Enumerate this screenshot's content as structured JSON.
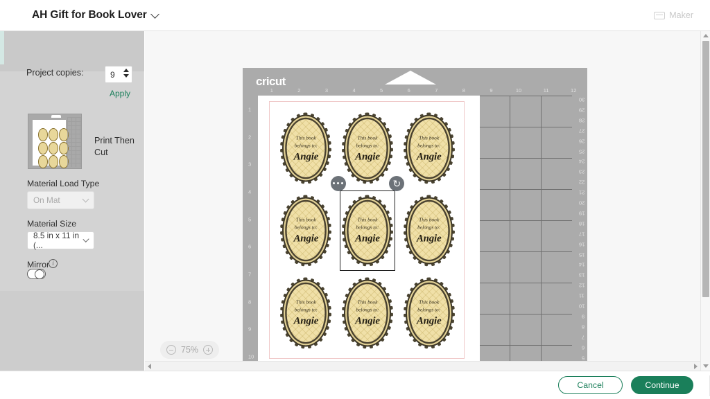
{
  "topbar": {
    "project_title": "AH Gift for Book Lover",
    "dropdown_icon": "chevron-down-icon",
    "machine_label": "Maker",
    "machine_icon": "cutting-machine-icon"
  },
  "sidebar": {
    "copies_label": "Project copies:",
    "copies_value": "9",
    "apply_label": "Apply",
    "operation_label": "Print Then Cut",
    "material_load_type_label": "Material Load Type",
    "material_load_type_value": "On Mat",
    "material_size_label": "Material Size",
    "material_size_value": "8.5 in x 11 in (...",
    "mirror_label": "Mirror",
    "mirror_info_icon": "info-icon",
    "mirror_state": "off"
  },
  "canvas": {
    "mat_brand": "cricut",
    "ruler_top": [
      "1",
      "2",
      "3",
      "4",
      "5",
      "6",
      "7",
      "8",
      "9",
      "10",
      "11",
      "12"
    ],
    "ruler_left": [
      "1",
      "2",
      "3",
      "4",
      "5",
      "6",
      "7",
      "8",
      "9",
      "10"
    ],
    "ruler_right": [
      "30",
      "29",
      "28",
      "27",
      "26",
      "25",
      "24",
      "23",
      "22",
      "21",
      "20",
      "19",
      "18",
      "17",
      "16",
      "15",
      "14",
      "13",
      "12",
      "11",
      "10",
      "9",
      "8",
      "7",
      "6",
      "5"
    ],
    "zoom_level": "75%",
    "zoom_out_icon": "minus-circle-icon",
    "zoom_in_icon": "plus-circle-icon",
    "selection": {
      "more_options_icon": "ellipsis-icon",
      "rotate_icon": "rotate-icon",
      "selected_index": 4
    },
    "labels": [
      {
        "line1": "This book",
        "line2": "belongs to:",
        "name": "Angie"
      },
      {
        "line1": "This book",
        "line2": "belongs to:",
        "name": "Angie"
      },
      {
        "line1": "This book",
        "line2": "belongs to:",
        "name": "Angie"
      },
      {
        "line1": "This book",
        "line2": "belongs to:",
        "name": "Angie"
      },
      {
        "line1": "This book",
        "line2": "belongs to:",
        "name": "Angie"
      },
      {
        "line1": "This book",
        "line2": "belongs to:",
        "name": "Angie"
      },
      {
        "line1": "This book",
        "line2": "belongs to:",
        "name": "Angie"
      },
      {
        "line1": "This book",
        "line2": "belongs to:",
        "name": "Angie"
      },
      {
        "line1": "This book",
        "line2": "belongs to:",
        "name": "Angie"
      }
    ]
  },
  "footer": {
    "cancel_label": "Cancel",
    "continue_label": "Continue"
  },
  "colors": {
    "accent_green": "#1a7f5a",
    "mat_gray": "#ababab",
    "panel_gray": "#d3d3d3",
    "label_cream": "#f0e0a8",
    "registration_pink": "#f0c9c9"
  }
}
